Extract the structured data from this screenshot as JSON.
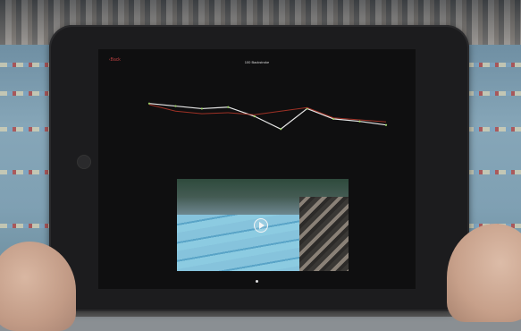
{
  "scene": {
    "description_colors": {
      "line_primary": "#ffffff",
      "line_secondary": "#c0392b",
      "back_accent": "#b84040"
    }
  },
  "screen": {
    "back_label": "Back",
    "title": "100 Backstroke"
  },
  "chart_data": {
    "type": "line",
    "series": [
      {
        "values": [
          40,
          39.5,
          39,
          39.3,
          37.5,
          35,
          39,
          37,
          36.5,
          35.8
        ]
      },
      {
        "values": [
          39.8,
          38.5,
          38,
          38.2,
          37.8,
          38.5,
          39.2,
          37.2,
          36.8,
          36.4
        ]
      }
    ]
  }
}
